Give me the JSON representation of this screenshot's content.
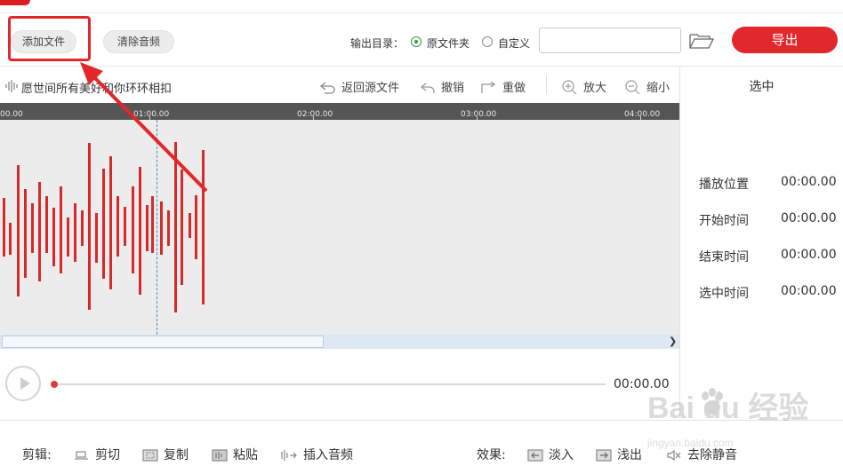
{
  "header": {
    "add_file": "添加文件",
    "clear_audio": "清除音频",
    "output_dir_label": "输出目录：",
    "radio_source_folder": "原文件夹",
    "radio_custom": "自定义",
    "path_value": "",
    "export": "导出",
    "output_selected": "原文件夹"
  },
  "toolbar": {
    "track_title": "愿世间所有美好和你环环相扣",
    "revert": "返回源文件",
    "undo": "撤销",
    "redo": "重做",
    "zoom_in": "放大",
    "zoom_out": "缩小"
  },
  "timeline": {
    "ticks": [
      "00.00",
      "01:00.00",
      "02:00.00",
      "03:00.00",
      "04:00.00"
    ],
    "playhead_time": "01:00.00"
  },
  "player": {
    "time": "00:00.00"
  },
  "selection_panel": {
    "title": "选中",
    "rows": [
      {
        "label": "播放位置",
        "value": "00:00.00"
      },
      {
        "label": "开始时间",
        "value": "00:00.00"
      },
      {
        "label": "结束时间",
        "value": "00:00.00"
      },
      {
        "label": "选中时间",
        "value": "00:00.00"
      }
    ]
  },
  "edit_bar": {
    "label": "剪辑:",
    "cut": "剪切",
    "copy": "复制",
    "paste": "粘贴",
    "insert_audio": "插入音频"
  },
  "effects_bar": {
    "label": "效果:",
    "fade_in": "淡入",
    "fade_out": "浅出",
    "remove_silence": "去除静音"
  },
  "watermark": {
    "brand": "Bai du 经验",
    "url": "jingyan.baidu.com"
  },
  "colors": {
    "accent": "#e1282c",
    "waveform": "#d62a2a",
    "playhead": "#3a8fd6",
    "ruler": "#555555",
    "wave_bg": "#ececec"
  }
}
